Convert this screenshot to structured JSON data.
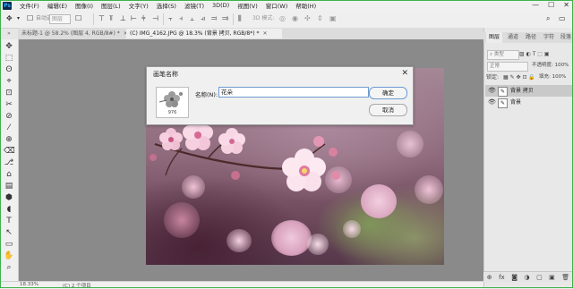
{
  "app": {
    "logo": "Ps"
  },
  "menu": [
    "文件(F)",
    "编辑(E)",
    "图像(I)",
    "图层(L)",
    "文字(Y)",
    "选择(S)",
    "滤镜(T)",
    "3D(D)",
    "视图(V)",
    "窗口(W)",
    "帮助(H)"
  ],
  "window_controls": {
    "minimize": "—",
    "maximize": "☐",
    "close": "✕"
  },
  "options_bar": {
    "move_tool_icon": "✥",
    "auto_select_label": "图层",
    "mode_label": "3D 模式:",
    "search_icon": "⌕",
    "workspace_icon": "▭"
  },
  "tabs": [
    {
      "label": "未标题-1 @ 58.2% (图层 4, RGB/8#) *",
      "active": false
    },
    {
      "label": "(C) IMG_4162.JPG @ 18.3% (背景 拷贝, RGB/8*) *",
      "active": true
    }
  ],
  "tools": [
    "✥",
    "⬚",
    "ʘ",
    "⌖",
    "⊡",
    "✂",
    "⊘",
    "⁄",
    "⊕",
    "⌫",
    "⎇",
    "⌂",
    "▤",
    "⬢",
    "◖",
    "T",
    "↖",
    "▭",
    "✋",
    "⌕"
  ],
  "status": {
    "zoom": "18.33%",
    "info": "(C) 2 个项目"
  },
  "panel": {
    "tabs": [
      "图层",
      "通道",
      "路径",
      "字符",
      "段落"
    ],
    "kind_label": "类型",
    "blend_mode": "正常",
    "opacity_label": "不透明度: 100%",
    "lock_label": "锁定:",
    "fill_label": "填充: 100%",
    "layers": [
      {
        "name": "背景 拷贝",
        "selected": true
      },
      {
        "name": "背景",
        "selected": false
      }
    ],
    "bottom_icons": [
      "⊕",
      "fx",
      "◙",
      "◑",
      "▢",
      "▣",
      "🗑"
    ]
  },
  "dialog": {
    "title": "画笔名称",
    "name_label": "名称(N):",
    "name_value": "花朵",
    "ok_label": "确定",
    "cancel_label": "取消",
    "brush_size": "976",
    "close_icon": "✕"
  }
}
